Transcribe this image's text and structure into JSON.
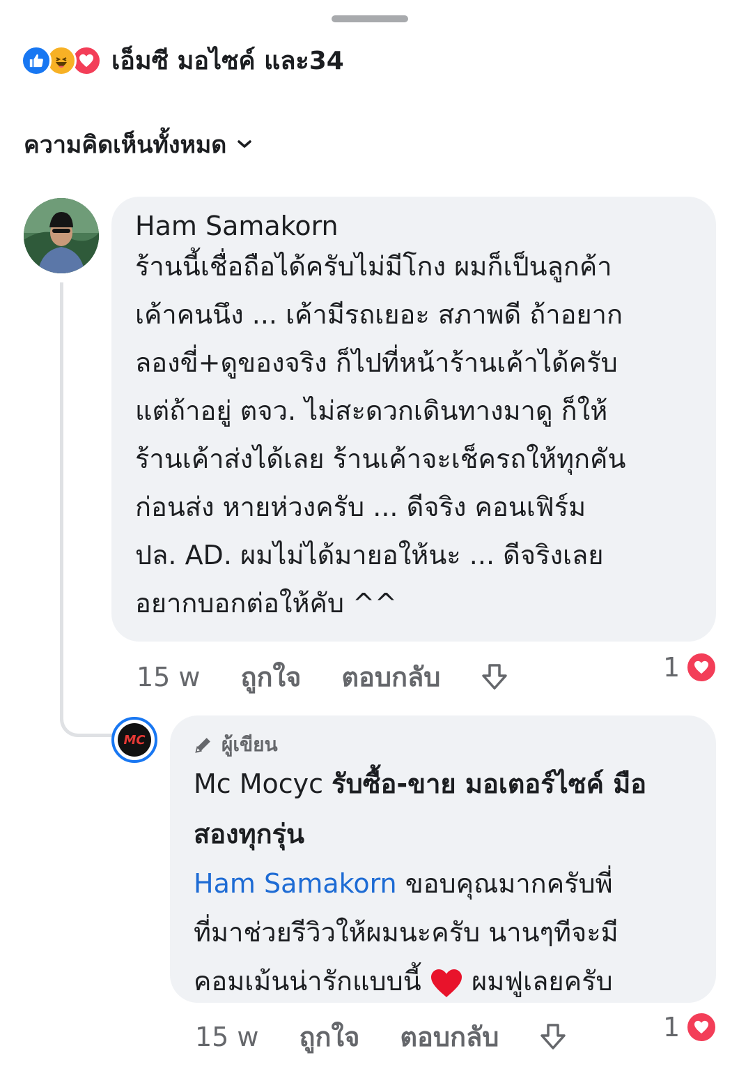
{
  "reactions": {
    "icons": [
      "like-icon",
      "haha-icon",
      "love-icon"
    ],
    "summary": "เอ็มซี มอไซค์ และ34"
  },
  "sort": {
    "label": "ความคิดเห็นทั้งหมด"
  },
  "comments": [
    {
      "author": "Ham Samakorn",
      "lines": [
        "ร้านนี้เชื่อถือได้ครับไม่มีโกง ผมก็เป็นลูกค้า",
        "เค้าคนนึง ... เค้ามีรถเยอะ สภาพดี ถ้าอยาก",
        "ลองขี่+ดูของจริง ก็ไปที่หน้าร้านเค้าได้ครับ",
        "แต่ถ้าอยู่ ตจว. ไม่สะดวกเดินทางมาดู ก็ให้",
        "ร้านเค้าส่งได้เลย ร้านเค้าจะเช็ครถให้ทุกคัน",
        "ก่อนส่ง หายห่วงครับ ... ดีจริง คอนเฟิร์ม",
        "ปล. AD. ผมไม่ได้มายอให้นะ ... ดีจริงเลย",
        "อยากบอกต่อให้คับ ^^"
      ],
      "time": "15 w",
      "like_label": "ถูกใจ",
      "reply_label": "ตอบกลับ",
      "reaction_count": "1"
    }
  ],
  "reply": {
    "badge": "ผู้เขียน",
    "page_name_prefix": "Mc Mocyc",
    "page_name_rest_1": "รับซื้อ-ขาย มอเตอร์ไซค์ มือ",
    "page_name_rest_2": "สองทุกรุ่น",
    "mention": "Ham Samakorn",
    "line1_rest": "ขอบคุณมากครับพี่",
    "line2": "ที่มาช่วยรีวิวให้ผมนะครับ นานๆทีจะมี",
    "line3_before": "คอมเม้นน่ารักแบบนี้",
    "line3_after": "ผมฟูเลยครับ",
    "time": "15 w",
    "like_label": "ถูกใจ",
    "reply_label": "ตอบกลับ",
    "reaction_count": "1",
    "avatar_text": "MC"
  }
}
